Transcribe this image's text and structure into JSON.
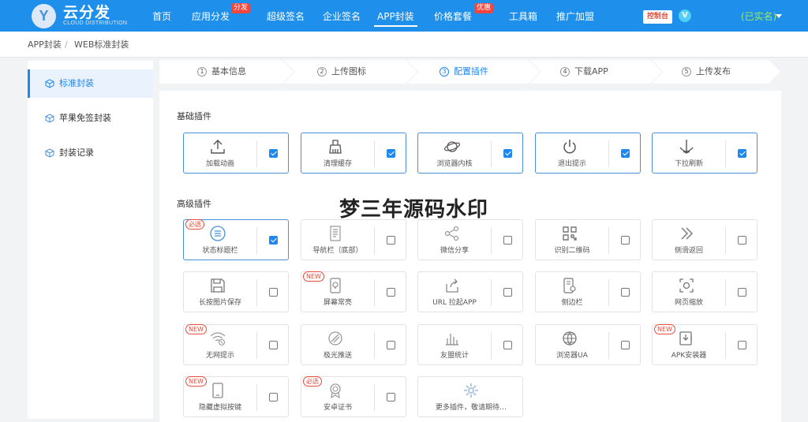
{
  "brand": {
    "logo_letter": "Y",
    "name": "云分发",
    "sub": "CLOUD DISTRIBUTION"
  },
  "nav": {
    "items": [
      {
        "label": "首页"
      },
      {
        "label": "应用分发",
        "badge": "分发"
      },
      {
        "label": "超级签名"
      },
      {
        "label": "企业签名"
      },
      {
        "label": "APP封装",
        "active": true
      },
      {
        "label": "价格套餐",
        "badge": "优惠"
      },
      {
        "label": "工具箱"
      },
      {
        "label": "推广加盟"
      }
    ],
    "console_label": "控制台",
    "vip_label": "V",
    "user_label": "(已实名)"
  },
  "breadcrumb": {
    "root": "APP封装",
    "separator": "/",
    "current": "WEB标准封装"
  },
  "sidebar": {
    "items": [
      {
        "label": "标准封装",
        "active": true
      },
      {
        "label": "苹果免签封装"
      },
      {
        "label": "封装记录"
      }
    ]
  },
  "steps": [
    {
      "num": "1",
      "label": "基本信息"
    },
    {
      "num": "2",
      "label": "上传图标"
    },
    {
      "num": "3",
      "label": "配置插件",
      "active": true
    },
    {
      "num": "4",
      "label": "下载APP"
    },
    {
      "num": "5",
      "label": "上传发布"
    }
  ],
  "basic": {
    "title": "基础插件",
    "plugins": [
      {
        "label": "加载动画",
        "icon": "upload-icon",
        "checked": true
      },
      {
        "label": "清理缓存",
        "icon": "broom-icon",
        "checked": true
      },
      {
        "label": "浏览器内核",
        "icon": "planet-icon",
        "checked": true
      },
      {
        "label": "退出提示",
        "icon": "power-icon",
        "checked": true
      },
      {
        "label": "下拉刷新",
        "icon": "anchor-icon",
        "checked": true
      }
    ]
  },
  "advanced": {
    "title": "高级插件",
    "plugins": [
      {
        "label": "状态标题栏",
        "icon": "menu-circle-icon",
        "checked": true,
        "tag": "必选"
      },
      {
        "label": "导航栏（底部）",
        "icon": "document-icon",
        "checked": false
      },
      {
        "label": "微信分享",
        "icon": "share-icon",
        "checked": false
      },
      {
        "label": "识别二维码",
        "icon": "qrcode-icon",
        "checked": false
      },
      {
        "label": "侧滑返回",
        "icon": "double-chevron-icon",
        "checked": false
      },
      {
        "label": "长按图片保存",
        "icon": "save-icon",
        "checked": false
      },
      {
        "label": "屏幕常亮",
        "icon": "phone-bulb-icon",
        "checked": false,
        "tag": "NEW"
      },
      {
        "label": "URL 拉起APP",
        "icon": "export-icon",
        "checked": false
      },
      {
        "label": "侧边栏",
        "icon": "phone-settings-icon",
        "checked": false
      },
      {
        "label": "网页缩放",
        "icon": "zoom-frame-icon",
        "checked": false
      },
      {
        "label": "无网提示",
        "icon": "wifi-off-icon",
        "checked": false,
        "tag": "NEW"
      },
      {
        "label": "极光推送",
        "icon": "push-icon",
        "checked": false
      },
      {
        "label": "友盟统计",
        "icon": "bar-stats-icon",
        "checked": false
      },
      {
        "label": "浏览器UA",
        "icon": "globe-icon",
        "checked": false
      },
      {
        "label": "APK安装器",
        "icon": "apk-icon",
        "checked": false,
        "tag": "NEW"
      },
      {
        "label": "隐藏虚拟按键",
        "icon": "tablet-icon",
        "checked": false,
        "tag": "NEW"
      },
      {
        "label": "安卓证书",
        "icon": "certificate-icon",
        "checked": false,
        "tag": "必选"
      },
      {
        "label": "更多插件，敬请期待…",
        "icon": "gear-spinner-icon",
        "more": true
      }
    ]
  },
  "watermark": "梦三年源码水印",
  "colors": {
    "topbar": "#1e8fea",
    "accent": "#1e87f0",
    "tag": "#e74c3c",
    "user": "#9eec58"
  }
}
